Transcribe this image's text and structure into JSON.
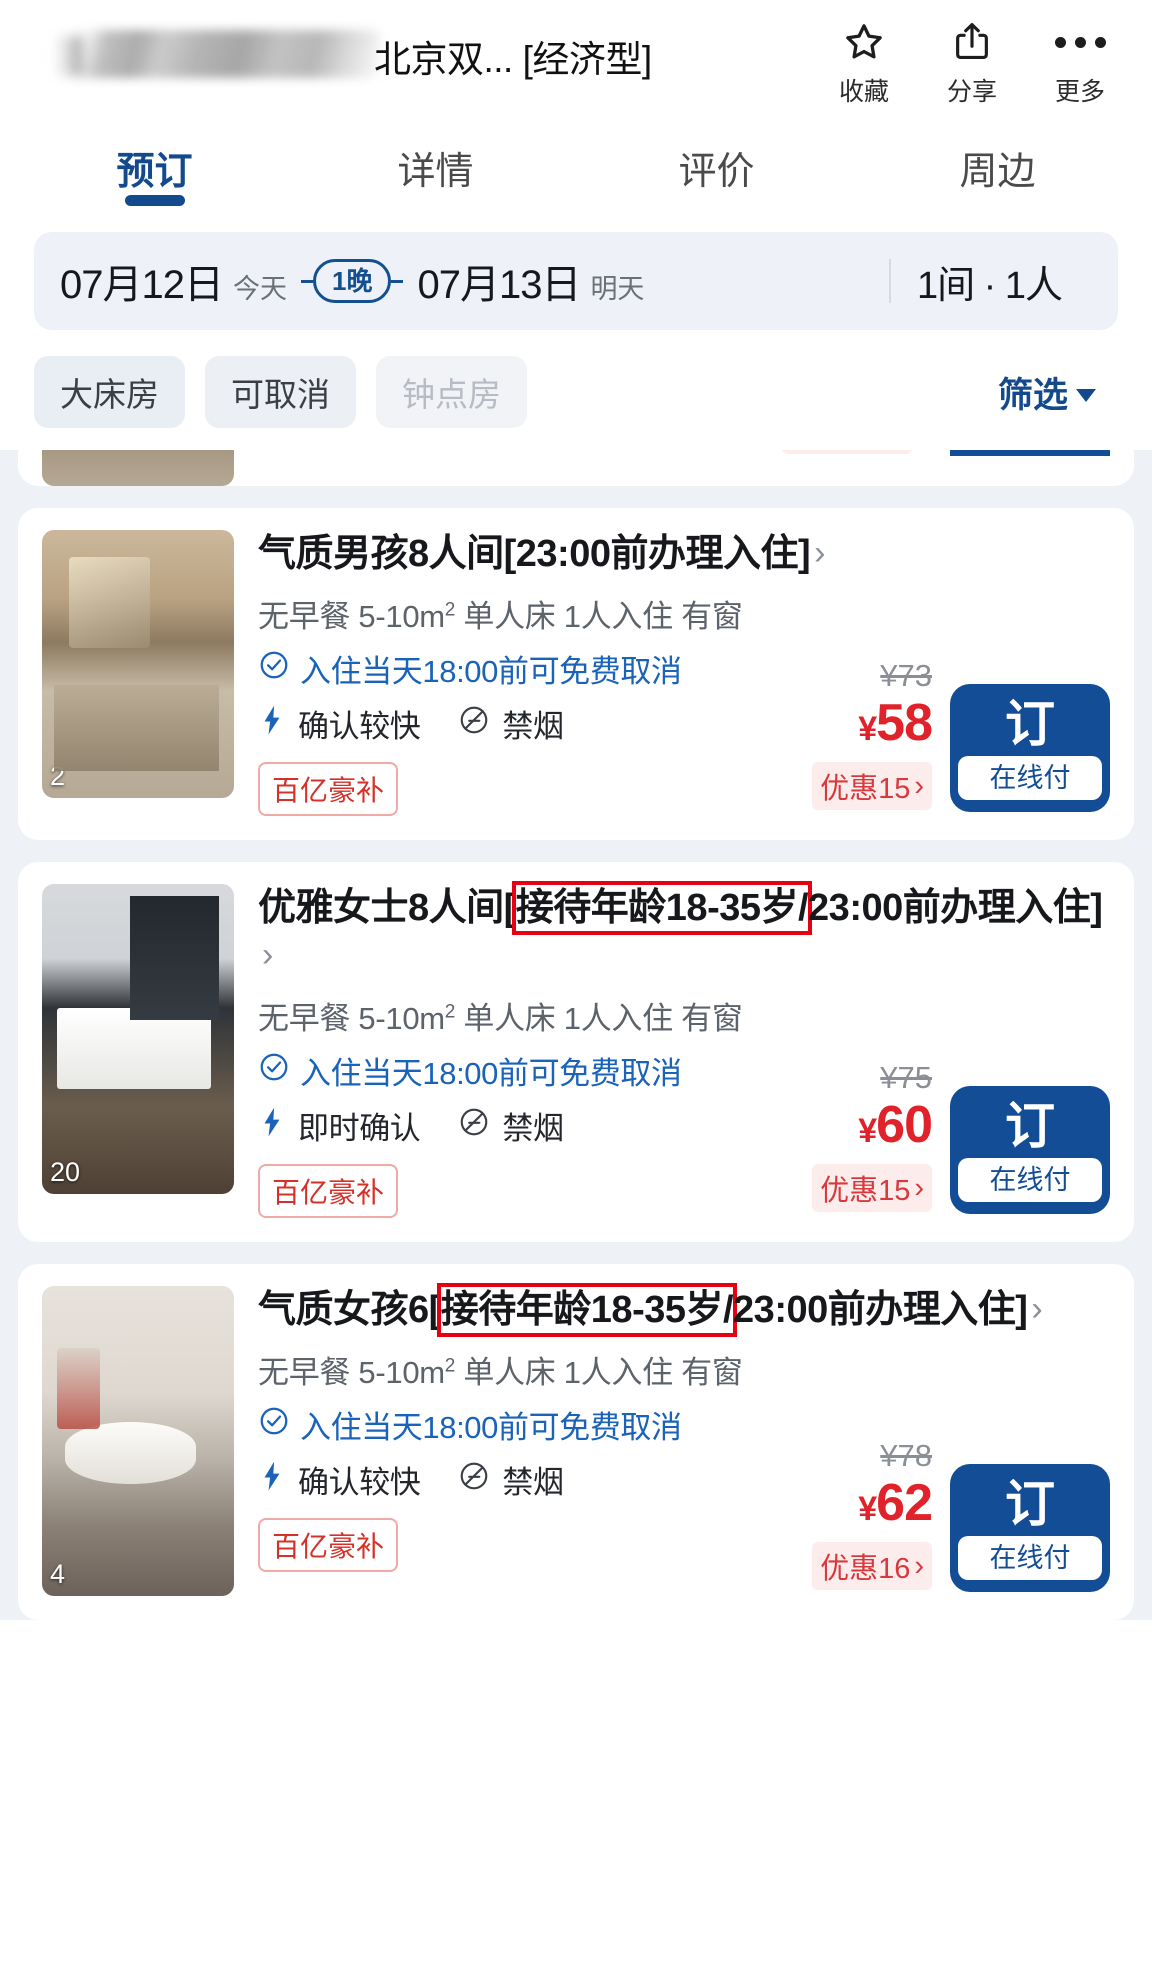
{
  "header": {
    "title_visible": "北京双... [经济型]",
    "actions": [
      {
        "name": "favorite",
        "icon": "star-icon",
        "label": "收藏"
      },
      {
        "name": "share",
        "icon": "share-icon",
        "label": "分享"
      },
      {
        "name": "more",
        "icon": "more-dots-icon",
        "label": "更多"
      }
    ]
  },
  "tabs": [
    {
      "label": "预订",
      "active": true
    },
    {
      "label": "详情",
      "active": false
    },
    {
      "label": "评价",
      "active": false
    },
    {
      "label": "周边",
      "active": false
    }
  ],
  "datebar": {
    "checkin_date": "07月12日",
    "checkin_label": "今天",
    "nights": "1晚",
    "checkout_date": "07月13日",
    "checkout_label": "明天",
    "guests": "1间 · 1人"
  },
  "filters": {
    "chips": [
      {
        "label": "大床房",
        "state": "normal"
      },
      {
        "label": "可取消",
        "state": "normal"
      },
      {
        "label": "钟点房",
        "state": "disabled"
      }
    ],
    "filter_label": "筛选"
  },
  "colors": {
    "brand_blue": "#124d96",
    "price_red": "#e0232b",
    "highlight_red": "#e60012",
    "promo_red": "#d4312a"
  },
  "rooms": [
    {
      "title_prefix": "气质男孩8人间[23:00前办理入住]",
      "title_highlight": "",
      "title_suffix": "",
      "photo_count": "2",
      "meta": "无早餐 5-10m² 单人床 1人入住 有窗",
      "cancel_policy": "入住当天18:00前可免费取消",
      "confirm_speed": "确认较快",
      "smoking": "禁烟",
      "promo": "百亿豪补",
      "price_old": "¥73",
      "price_new": "58",
      "currency": "¥",
      "discount": "优惠15",
      "book_label": "订",
      "pay_label": "在线付"
    },
    {
      "title_prefix": "优雅女士8人间[",
      "title_highlight": "接待年龄18-35岁/",
      "title_suffix": "23:00前办理入住]",
      "photo_count": "20",
      "meta": "无早餐 5-10m² 单人床 1人入住 有窗",
      "cancel_policy": "入住当天18:00前可免费取消",
      "confirm_speed": "即时确认",
      "smoking": "禁烟",
      "promo": "百亿豪补",
      "price_old": "¥75",
      "price_new": "60",
      "currency": "¥",
      "discount": "优惠15",
      "book_label": "订",
      "pay_label": "在线付"
    },
    {
      "title_prefix": "气质女孩6[",
      "title_highlight": "接待年龄18-35岁/",
      "title_suffix": "23:00前办理入住]",
      "photo_count": "4",
      "meta": "无早餐 5-10m² 单人床 1人入住 有窗",
      "cancel_policy": "入住当天18:00前可免费取消",
      "confirm_speed": "确认较快",
      "smoking": "禁烟",
      "promo": "百亿豪补",
      "price_old": "¥78",
      "price_new": "62",
      "currency": "¥",
      "discount": "优惠16",
      "book_label": "订",
      "pay_label": "在线付"
    }
  ]
}
